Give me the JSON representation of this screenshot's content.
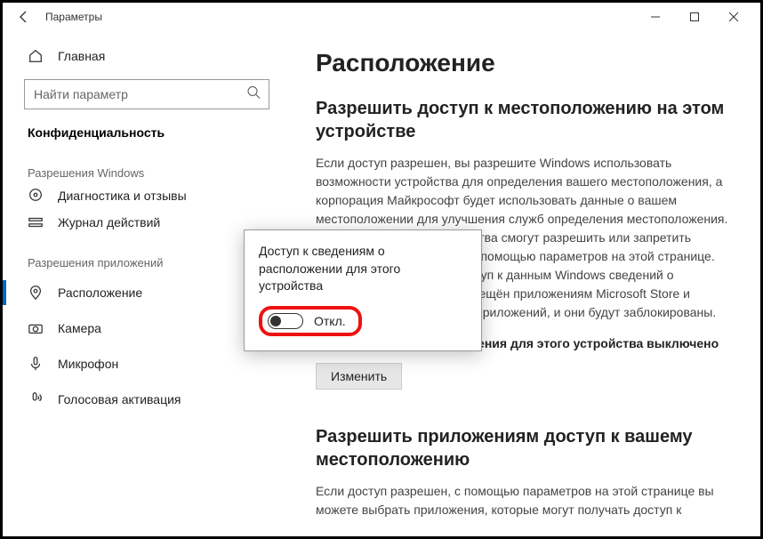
{
  "titlebar": {
    "title": "Параметры"
  },
  "sidebar": {
    "home_label": "Главная",
    "search_placeholder": "Найти параметр",
    "category_label": "Конфиденциальность",
    "section_windows": "Разрешения Windows",
    "section_apps": "Разрешения приложений",
    "items_windows": [
      {
        "label": "Диагностика и отзывы"
      },
      {
        "label": "Журнал действий"
      }
    ],
    "items_apps": [
      {
        "label": "Расположение"
      },
      {
        "label": "Камера"
      },
      {
        "label": "Микрофон"
      },
      {
        "label": "Голосовая активация"
      }
    ]
  },
  "content": {
    "page_title": "Расположение",
    "h2_1": "Разрешить доступ к местоположению на этом устройстве",
    "p1": "Если доступ разрешен, вы разрешите Windows использовать возможности устройства для определения вашего местоположения, а корпорация Майкрософт будет использовать данные о вашем местоположении для улучшения служб определения местоположения. Пользователи этого устройства смогут разрешить или запретить доступ к местоположению с помощью параметров на этой странице. Если доступ запрещен, доступ к данным Windows сведений о местоположении будет запрещён приложениям Microsoft Store и большинству классических приложений, и они будут заблокированы.",
    "status_line": "Определение местоположения для этого устройства выключено",
    "change_btn": "Изменить",
    "h2_2": "Разрешить приложениям доступ к вашему местоположению",
    "p2": "Если доступ разрешен, с помощью параметров на этой странице вы можете выбрать приложения, которые могут получать доступ к"
  },
  "popup": {
    "title": "Доступ к сведениям о расположении для этого устройства",
    "toggle_label": "Откл."
  }
}
